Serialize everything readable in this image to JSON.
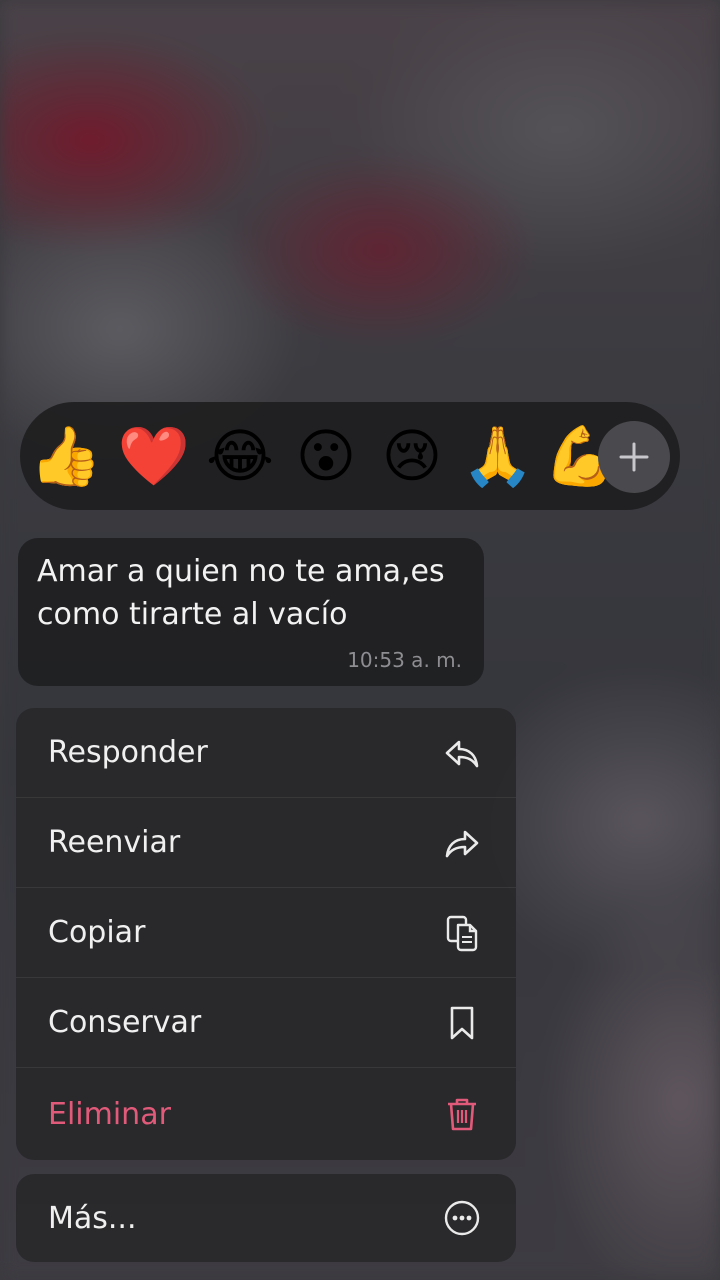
{
  "reactions": {
    "emojis": [
      "👍",
      "❤️",
      "😂",
      "😮",
      "😢",
      "🙏",
      "💪"
    ],
    "more_icon": "plus-icon"
  },
  "message": {
    "text": "Amar a quien no te ama,es como tirarte al vacío",
    "time": "10:53 a. m."
  },
  "menu": {
    "items": [
      {
        "label": "Responder",
        "icon": "reply-icon"
      },
      {
        "label": "Reenviar",
        "icon": "forward-icon"
      },
      {
        "label": "Copiar",
        "icon": "copy-icon"
      },
      {
        "label": "Conservar",
        "icon": "bookmark-icon"
      },
      {
        "label": "Eliminar",
        "icon": "trash-icon",
        "color": "#e25a7a"
      }
    ],
    "more": {
      "label": "Más...",
      "icon": "more-icon"
    }
  }
}
